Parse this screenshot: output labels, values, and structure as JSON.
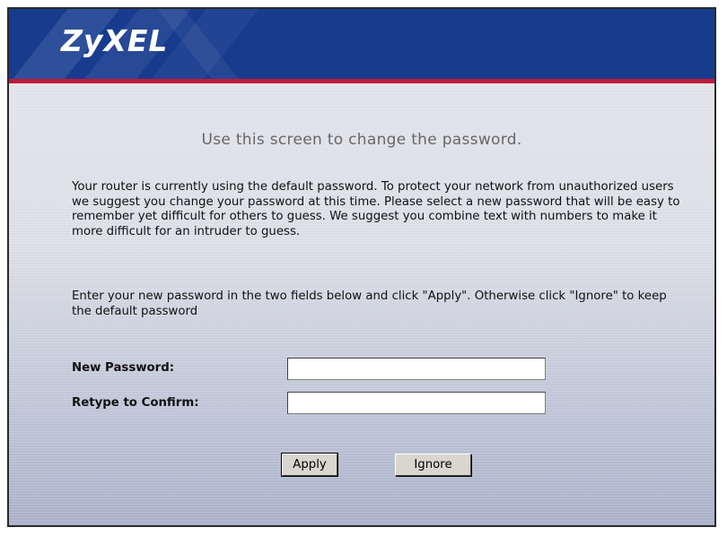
{
  "header": {
    "logo_text": "ZyXEL"
  },
  "main": {
    "heading": "Use this screen to change the password.",
    "paragraph1": "Your router is currently using the default password. To protect your network from unauthorized users we suggest you change your password at this time. Please select a new password that will be easy to remember yet difficult for others to guess. We suggest you combine text with numbers to make it more difficult for an intruder to guess.",
    "paragraph2": "Enter your new password in the two fields below and click \"Apply\". Otherwise click \"Ignore\" to keep the default password"
  },
  "form": {
    "new_password_label": "New Password:",
    "new_password_value": "",
    "confirm_label": "Retype to Confirm:",
    "confirm_value": ""
  },
  "buttons": {
    "apply_label": "Apply",
    "ignore_label": "Ignore"
  },
  "colors": {
    "header_blue": "#173c8e",
    "accent_red": "#c2183a",
    "heading_gray": "#676767"
  }
}
